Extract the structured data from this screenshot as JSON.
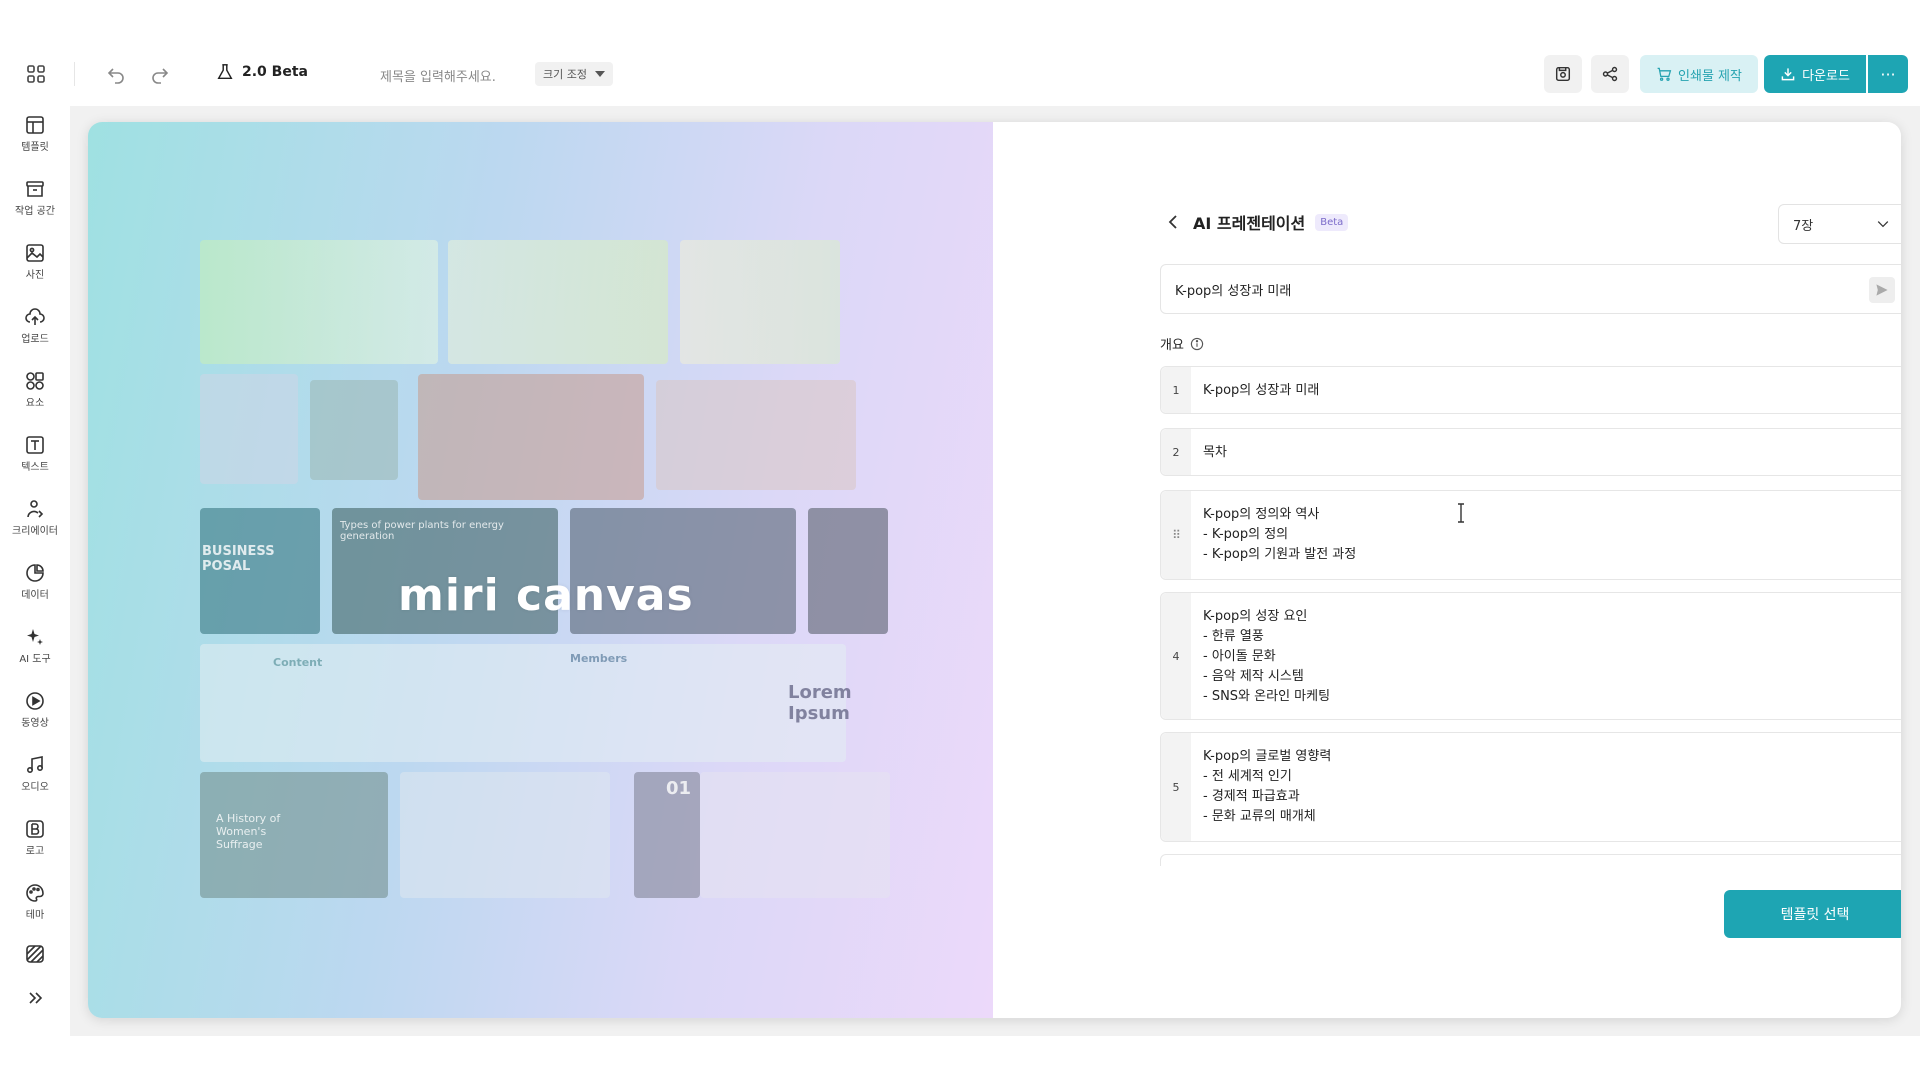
{
  "topbar": {
    "app_version": "2.0 Beta",
    "title_placeholder": "제목을 입력해주세요.",
    "resize_label": "크기 조정",
    "print_label": "인쇄물 제작",
    "download_label": "다운로드",
    "more_label": "···"
  },
  "sidebar": {
    "items": [
      {
        "label": "템플릿",
        "icon": "template-icon"
      },
      {
        "label": "작업 공간",
        "icon": "archive-icon"
      },
      {
        "label": "사진",
        "icon": "image-icon"
      },
      {
        "label": "업로드",
        "icon": "upload-cloud-icon"
      },
      {
        "label": "요소",
        "icon": "shapes-icon"
      },
      {
        "label": "텍스트",
        "icon": "text-icon"
      },
      {
        "label": "크리에이터",
        "icon": "creator-icon"
      },
      {
        "label": "데이터",
        "icon": "chart-icon"
      },
      {
        "label": "AI 도구",
        "icon": "sparkle-icon"
      },
      {
        "label": "동영상",
        "icon": "play-icon"
      },
      {
        "label": "오디오",
        "icon": "music-icon"
      },
      {
        "label": "로고",
        "icon": "logo-b-icon"
      },
      {
        "label": "테마",
        "icon": "palette-icon"
      }
    ]
  },
  "hero": {
    "logo_text": "miri canvas",
    "thumb_business": "BUSINESS\nPOSAL",
    "thumb_power": "Types of power plants for energy generation",
    "thumb_history": "A History of Women's Suffrage",
    "thumb_lorem": "Lorem Ipsum",
    "thumb_content": "Content",
    "thumb_members": "Members",
    "thumb_number": "01"
  },
  "panel": {
    "title": "AI 프레젠테이션",
    "beta_badge": "Beta",
    "slide_count": "7장",
    "prompt_value": "K-pop의 성장과 미래",
    "outline_label": "개요",
    "slides": [
      {
        "num": "1",
        "text": "K-pop의 성장과 미래"
      },
      {
        "num": "2",
        "text": "목차"
      },
      {
        "num": "",
        "text": "K-pop의 정의와 역사\n- K-pop의 정의\n- K-pop의 기원과 발전 과정"
      },
      {
        "num": "4",
        "text": "K-pop의 성장 요인\n- 한류 열풍\n- 아이돌 문화\n- 음악 제작 시스템\n- SNS와 온라인 마케팅"
      },
      {
        "num": "5",
        "text": "K-pop의 글로벌 영향력\n- 전 세계적 인기\n- 경제적 파급효과\n- 문화 교류의 매개체"
      }
    ],
    "template_button": "템플릿 선택"
  },
  "colors": {
    "accent": "#1ea5b3",
    "accent_light": "#d9f1f4",
    "beta_badge": "#7b6bc9"
  }
}
